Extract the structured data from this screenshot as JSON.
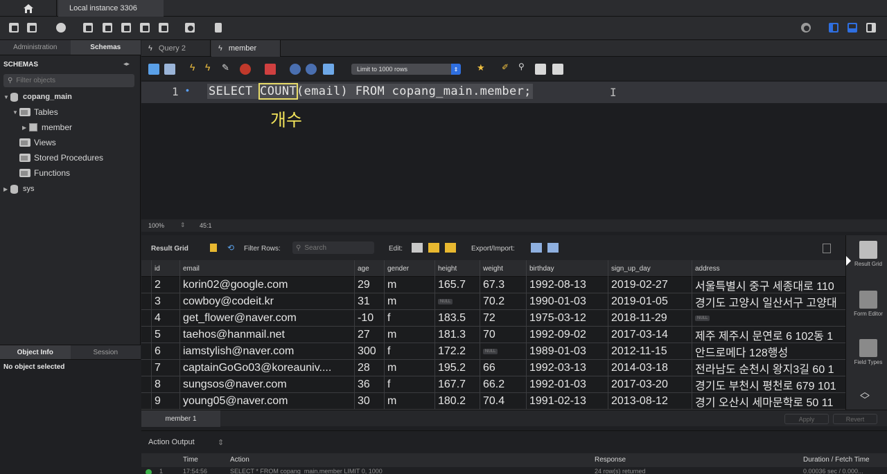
{
  "window": {
    "connection_tab": "Local instance 3306"
  },
  "sidebar": {
    "tabs": [
      "Administration",
      "Schemas"
    ],
    "header": "SCHEMAS",
    "filter_placeholder": "Filter objects",
    "tree": {
      "schema": "copang_main",
      "tables_folder": "Tables",
      "table": "member",
      "views": "Views",
      "procs": "Stored Procedures",
      "funcs": "Functions",
      "schema2": "sys"
    },
    "bottom_tabs": [
      "Object Info",
      "Session"
    ],
    "no_object": "No object selected"
  },
  "query_tabs": [
    "Query 2",
    "member"
  ],
  "editor_toolbar": {
    "limit": "Limit to 1000 rows"
  },
  "editor": {
    "line_number": "1",
    "sql_before": "SELECT ",
    "sql_keyword": "COUNT",
    "sql_after": "(email) FROM copang_main.member;",
    "annotation": "개수"
  },
  "status": {
    "zoom": "100%",
    "position": "45:1"
  },
  "result_toolbar": {
    "result_grid": "Result Grid",
    "filter_rows": "Filter Rows:",
    "search_placeholder": "Search",
    "edit": "Edit:",
    "export_import": "Export/Import:"
  },
  "grid": {
    "columns": [
      "id",
      "email",
      "age",
      "gender",
      "height",
      "weight",
      "birthday",
      "sign_up_day",
      "address"
    ],
    "null_label": "NULL",
    "rows": [
      [
        "2",
        "korin02@google.com",
        "29",
        "m",
        "165.7",
        "67.3",
        "1992-08-13",
        "2019-02-27",
        "서울특별시 중구 세종대로 110"
      ],
      [
        "3",
        "cowboy@codeit.kr",
        "31",
        "m",
        "",
        "70.2",
        "1990-01-03",
        "2019-01-05",
        "경기도 고양시 일산서구 고양대"
      ],
      [
        "4",
        "get_flower@naver.com",
        "-10",
        "f",
        "183.5",
        "72",
        "1975-03-12",
        "2018-11-29",
        ""
      ],
      [
        "5",
        "taehos@hanmail.net",
        "27",
        "m",
        "181.3",
        "70",
        "1992-09-02",
        "2017-03-14",
        "제주 제주시 문연로 6 102동 1"
      ],
      [
        "6",
        "iamstylish@naver.com",
        "300",
        "f",
        "172.2",
        "",
        "1989-01-03",
        "2012-11-15",
        "안드로메다 128행성"
      ],
      [
        "7",
        "captainGoGo03@koreauniv....",
        "28",
        "m",
        "195.2",
        "66",
        "1992-03-13",
        "2014-03-18",
        "전라남도 순천시 왕지3길 60 1"
      ],
      [
        "8",
        "sungsos@naver.com",
        "36",
        "f",
        "167.7",
        "66.2",
        "1992-01-03",
        "2017-03-20",
        "경기도 부천시 평천로 679 101"
      ],
      [
        "9",
        "young05@naver.com",
        "30",
        "m",
        "180.2",
        "70.4",
        "1991-02-13",
        "2013-08-12",
        "경기 오산시 세마문학로 50 11"
      ]
    ]
  },
  "right_panel": [
    "Result Grid",
    "Form Editor",
    "Field Types"
  ],
  "result_tabs": {
    "tab": "member 1",
    "apply": "Apply",
    "revert": "Revert"
  },
  "action_output": {
    "title": "Action Output",
    "columns": [
      "Time",
      "Action",
      "Response",
      "Duration / Fetch Time"
    ],
    "row": {
      "num": "1",
      "time": "17:54:56",
      "action": "SELECT * FROM copang_main.member LIMIT 0, 1000",
      "response": "24 row(s) returned",
      "duration": "0.00036 sec / 0.000..."
    }
  },
  "colors": {
    "accent": "#2f6fe0",
    "annotation": "#f2e35a"
  }
}
